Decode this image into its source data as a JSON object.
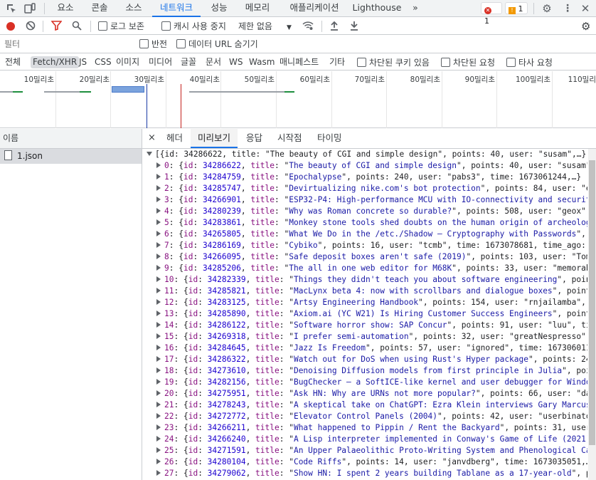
{
  "topbar": {
    "tabs": [
      "요소",
      "콘솔",
      "소스",
      "네트워크",
      "성능",
      "메모리",
      "애플리케이션",
      "Lighthouse"
    ],
    "active_tab": "네트워크",
    "more": "»",
    "errors": "1",
    "warnings": "1"
  },
  "toolbar": {
    "preserve_log": "로그 보존",
    "disable_cache": "캐시 사용 중지",
    "throttle": "제한 없음"
  },
  "filter": {
    "placeholder": "필터",
    "invert": "반전",
    "hide_data_urls": "데이터 URL 숨기기"
  },
  "types": {
    "items": [
      "전체",
      "Fetch/XHR",
      "JS",
      "CSS",
      "이미지",
      "미디어",
      "글꼴",
      "문서",
      "WS",
      "Wasm",
      "매니페스트",
      "기타"
    ],
    "active": "Fetch/XHR",
    "blocked_cookies": "차단된 쿠키 있음",
    "blocked_requests": "차단된 요청",
    "third_party": "타사 요청"
  },
  "overview": {
    "ticks": [
      "10밀리초",
      "20밀리초",
      "30밀리초",
      "40밀리초",
      "50밀리초",
      "60밀리초",
      "70밀리초",
      "80밀리초",
      "90밀리초",
      "100밀리초",
      "110밀리"
    ]
  },
  "requests": {
    "header": "이름",
    "items": [
      "1.json"
    ]
  },
  "detail": {
    "close": "×",
    "tabs": [
      "헤더",
      "미리보기",
      "응답",
      "시작점",
      "타이밍"
    ],
    "active": "미리보기"
  },
  "preview": {
    "summary": "[{id: 34286622, title: \"The beauty of CGI and simple design\", points: 40, user: \"susam\",…},…",
    "items": [
      {
        "i": "0",
        "id": "34286622",
        "title": "The beauty of CGI and simple design",
        "rest": ", points: 40, user: \"susam\",…"
      },
      {
        "i": "1",
        "id": "34284759",
        "title": "Epochalypse",
        "rest": ", points: 240, user: \"pabs3\", time: 1673061244,…}"
      },
      {
        "i": "2",
        "id": "34285747",
        "title": "Devirtualizing nike.com's bot protection",
        "rest": ", points: 84, user: \"el"
      },
      {
        "i": "3",
        "id": "34266901",
        "title": "ESP32-P4: High-performance MCU with IO-connectivity and security",
        "rest": ""
      },
      {
        "i": "4",
        "id": "34280239",
        "title": "Why was Roman concrete so durable?",
        "rest": ", points: 508, user: \"geox\",…}"
      },
      {
        "i": "5",
        "id": "34283861",
        "title": "Monkey stone tools shed doubts on the human origin of archeologic",
        "rest": ""
      },
      {
        "i": "6",
        "id": "34265805",
        "title": "What We Do in the /etc./Shadow – Cryptography with Passwords",
        "rest": ", po"
      },
      {
        "i": "7",
        "id": "34286169",
        "title": "Cybiko",
        "rest": ", points: 16, user: \"tcmb\", time: 1673078681, time_ago: \""
      },
      {
        "i": "8",
        "id": "34266095",
        "title": "Safe deposit boxes aren't safe (2019)",
        "rest": ", points: 103, user: \"Tomte"
      },
      {
        "i": "9",
        "id": "34285206",
        "title": "The all in one web editor for M68K",
        "rest": ", points: 33, user: \"memorable"
      },
      {
        "i": "10",
        "id": "34282339",
        "title": "Things they didn't teach you about software engineering",
        "rest": ", points"
      },
      {
        "i": "11",
        "id": "34285821",
        "title": "MacLynx beta 4: now with scrollbars and dialogue boxes",
        "rest": ", points"
      },
      {
        "i": "12",
        "id": "34283125",
        "title": "Artsy Engineering Handbook",
        "rest": ", points: 154, user: \"rnjailamba\", ti"
      },
      {
        "i": "13",
        "id": "34285890",
        "title": "Axiom.ai (YC W21) Is Hiring Customer Success Engineers",
        "rest": ", points"
      },
      {
        "i": "14",
        "id": "34286122",
        "title": "Software horror show: SAP Concur",
        "rest": ", points: 91, user: \"luu\", time"
      },
      {
        "i": "15",
        "id": "34269318",
        "title": "I prefer semi-automation",
        "rest": ", points: 32, user: \"greatNespresso\", t"
      },
      {
        "i": "16",
        "id": "34284645",
        "title": "Jazz Is Freedom",
        "rest": ", points: 57, user: \"ignored\", time: 1673060118,"
      },
      {
        "i": "17",
        "id": "34286322",
        "title": "Watch out for DoS when using Rust's Hyper package",
        "rest": ", points: 24, u"
      },
      {
        "i": "18",
        "id": "34273610",
        "title": "Denoising Diffusion models from first principle in Julia",
        "rest": ", point"
      },
      {
        "i": "19",
        "id": "34282156",
        "title": "BugChecker – a SoftICE-like kernel and user debugger for Windows",
        "rest": ""
      },
      {
        "i": "20",
        "id": "34275951",
        "title": "Ask HN: Why are URNs not more popular?",
        "rest": ", points: 66, user: \"dagg"
      },
      {
        "i": "21",
        "id": "34278243",
        "title": "A skeptical take on ChatGPT: Ezra Klein interviews Gary Marcus",
        "rest": ""
      },
      {
        "i": "22",
        "id": "34272772",
        "title": "Elevator Control Panels (2004)",
        "rest": ", points: 42, user: \"userbinator\""
      },
      {
        "i": "23",
        "id": "34266211",
        "title": "What happened to Pippin / Rent the Backyard",
        "rest": ", points: 31, user: \""
      },
      {
        "i": "24",
        "id": "34266240",
        "title": "A Lisp interpreter implemented in Conway's Game of Life (2021)",
        "rest": ""
      },
      {
        "i": "25",
        "id": "34271591",
        "title": "An Upper Palaeolithic Proto-Writing System and Phenological Cale",
        "rest": ""
      },
      {
        "i": "26",
        "id": "34280104",
        "title": "Code Riffs",
        "rest": ", points: 14, user: \"janvdberg\", time: 1673035051,…}"
      },
      {
        "i": "27",
        "id": "34279062",
        "title": "Show HN: I spent 2 years building Tablane as a 17-year-old",
        "rest": ", po"
      }
    ]
  }
}
